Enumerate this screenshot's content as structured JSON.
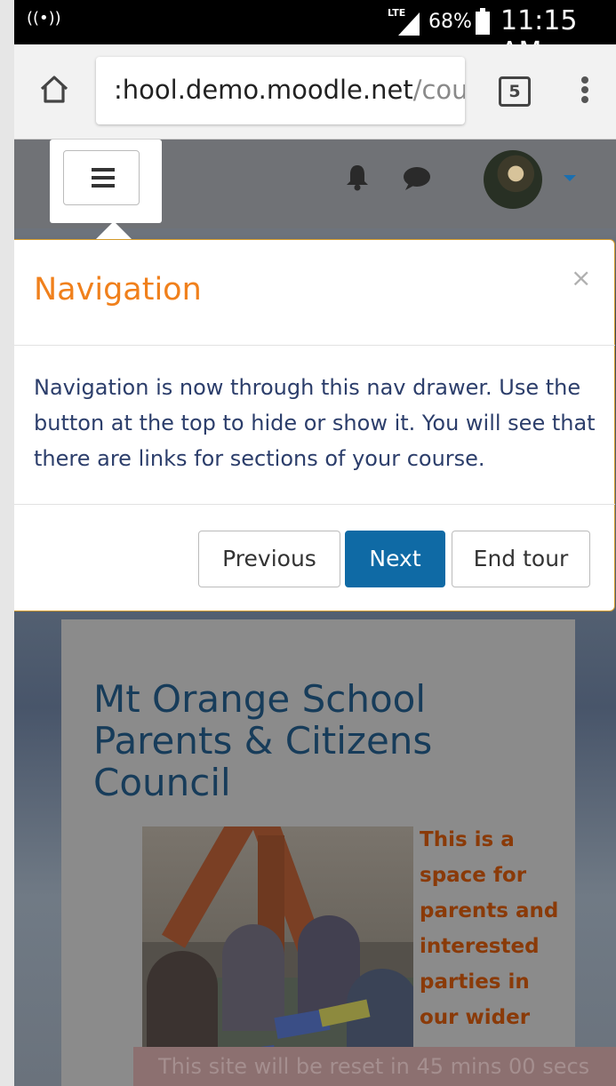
{
  "status_bar": {
    "network_type": "LTE",
    "battery_percent": "68%",
    "time": "11:15 AM",
    "icons": [
      "wireless-signal-icon",
      "cell-signal-icon",
      "battery-icon"
    ]
  },
  "browser": {
    "url_host": ":hool.demo.moodle.net",
    "url_path": "/cou",
    "tab_count": "5",
    "icons": [
      "home-icon",
      "tabs-icon",
      "overflow-menu-icon"
    ]
  },
  "navbar": {
    "icons": [
      "hamburger-menu-icon",
      "bell-icon",
      "chat-bubble-icon",
      "avatar",
      "caret-down-icon"
    ]
  },
  "tour": {
    "title": "Navigation",
    "close_label": "×",
    "body": "Navigation is now through this nav drawer. Use the button at the top to hide or show it. You will see that there are links for sections of your course.",
    "buttons": {
      "previous": "Previous",
      "next": "Next",
      "end": "End tour"
    },
    "accent_color": "#f0801c",
    "primary_button_color": "#0f6aa5"
  },
  "course": {
    "title": "Mt Orange School Parents & Citizens Council",
    "blurb": "This is a space for parents and interested parties in our wider"
  },
  "reset_banner": "This site will be reset in 45 mins 00 secs"
}
